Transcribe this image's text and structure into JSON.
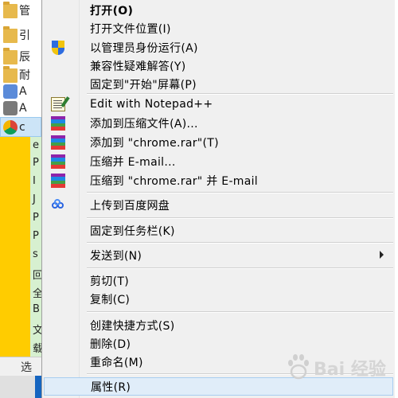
{
  "context_menu": {
    "items": [
      {
        "label": "打开(O)",
        "icon": "none",
        "bold": true
      },
      {
        "label": "打开文件位置(I)",
        "icon": "none"
      },
      {
        "label": "以管理员身份运行(A)",
        "icon": "uac-shield-icon"
      },
      {
        "label": "兼容性疑难解答(Y)",
        "icon": "none"
      },
      {
        "label": "固定到\"开始\"屏幕(P)",
        "icon": "none"
      },
      {
        "label": "Edit with Notepad++",
        "icon": "notepad-plus-plus-icon"
      },
      {
        "label": "添加到压缩文件(A)...",
        "icon": "winrar-icon"
      },
      {
        "label": "添加到 \"chrome.rar\"(T)",
        "icon": "winrar-icon"
      },
      {
        "label": "压缩并 E-mail...",
        "icon": "winrar-icon"
      },
      {
        "label": "压缩到 \"chrome.rar\" 并 E-mail",
        "icon": "winrar-icon"
      },
      {
        "label": "上传到百度网盘",
        "icon": "baidu-netdisk-icon"
      },
      {
        "label": "固定到任务栏(K)",
        "icon": "none"
      },
      {
        "label": "发送到(N)",
        "icon": "none",
        "submenu": true
      },
      {
        "label": "剪切(T)",
        "icon": "none"
      },
      {
        "label": "复制(C)",
        "icon": "none"
      },
      {
        "label": "创建快捷方式(S)",
        "icon": "none"
      },
      {
        "label": "删除(D)",
        "icon": "none"
      },
      {
        "label": "重命名(M)",
        "icon": "none"
      },
      {
        "label": "属性(R)",
        "icon": "none",
        "highlighted": true
      }
    ]
  },
  "background": {
    "rows": [
      "管",
      "引",
      "辰",
      "耐",
      "A",
      "A",
      "c"
    ],
    "side_letters": [
      "e",
      "P",
      "I",
      "J",
      "P",
      "P",
      "s",
      "回",
      "全",
      "B",
      "文",
      "载"
    ],
    "bottom_label": "选"
  },
  "watermark": {
    "text": "Bai 经验"
  },
  "colors": {
    "menu_bg": "#f0f0f0",
    "highlight": "#e0edf9",
    "start_yellow": "#ffcc00",
    "winrar_stripes": [
      "#8e24aa",
      "#1e88e5",
      "#43a047",
      "#e53935"
    ]
  }
}
